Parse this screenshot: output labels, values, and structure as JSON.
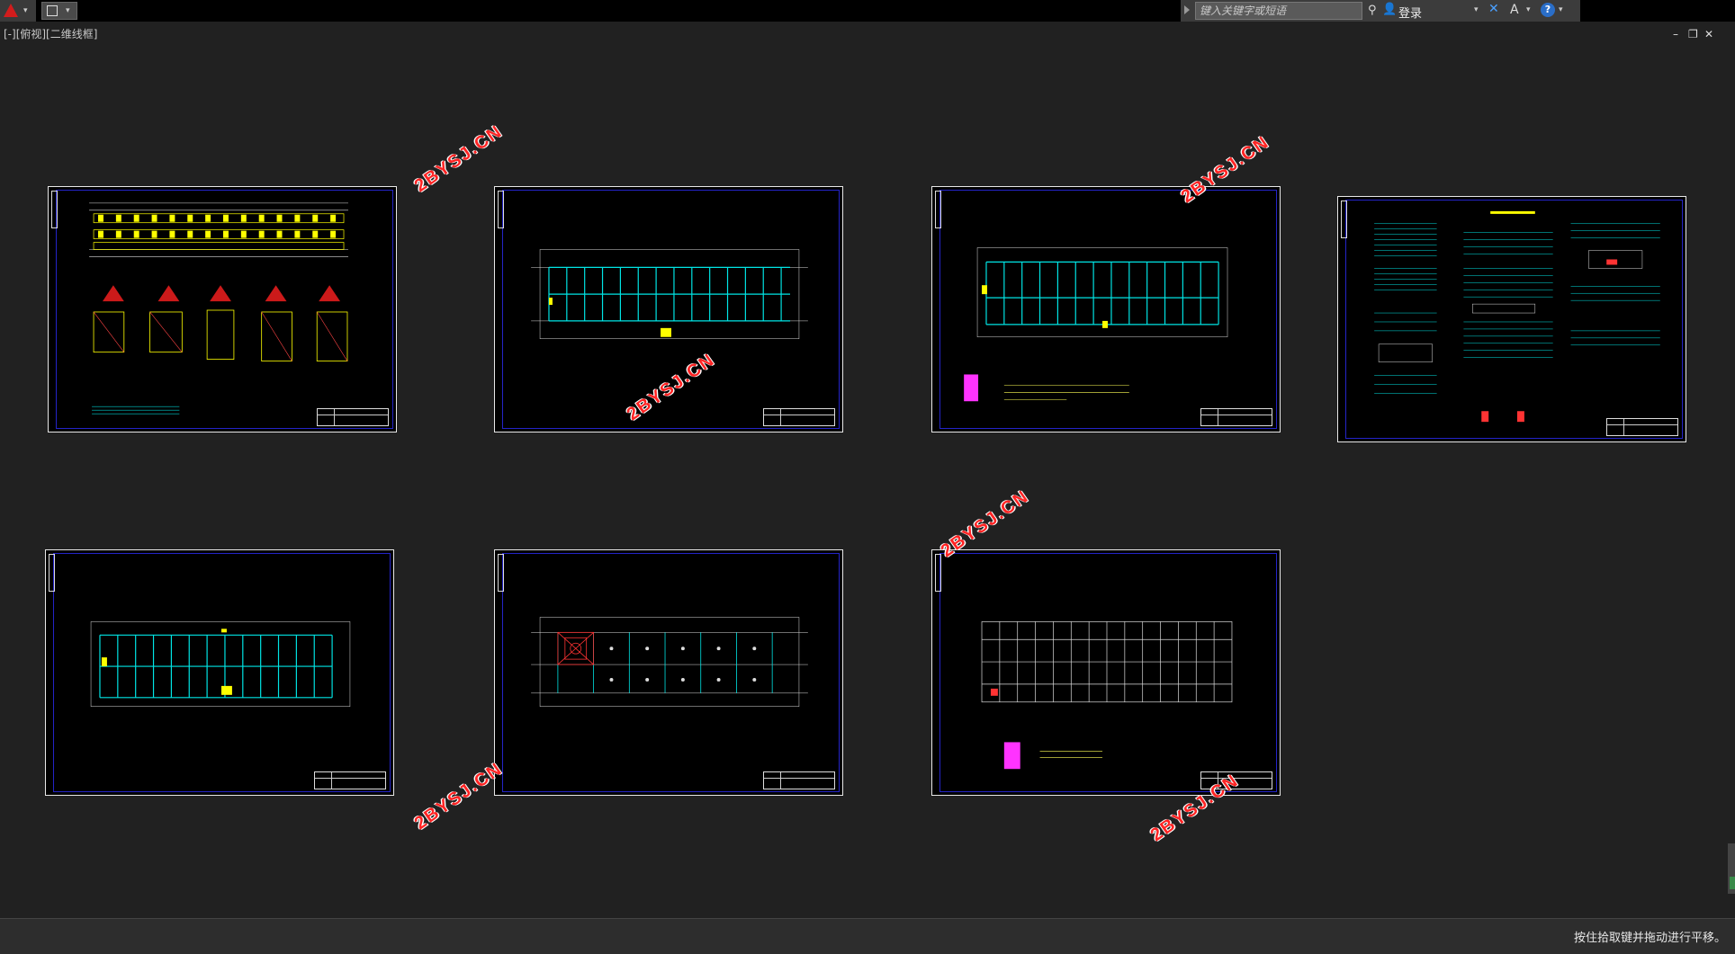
{
  "app": {
    "search_placeholder": "键入关键字或短语",
    "login_label": "登录",
    "viewport_label": "[-][俯视][二维线框]",
    "status_message": "按住拾取键并拖动进行平移。"
  },
  "window_controls": [
    "–",
    "❐",
    "✕"
  ],
  "watermark_text": "2BYSJ.CN",
  "sheets": [
    {
      "id": "foundation-plan",
      "color_accent": "#ffff00"
    },
    {
      "id": "floor-plan-1",
      "color_accent": "#00ffff"
    },
    {
      "id": "floor-plan-2",
      "color_accent": "#00ffff"
    },
    {
      "id": "design-notes",
      "color_accent": "#00ffff"
    },
    {
      "id": "floor-plan-3",
      "color_accent": "#00ffff"
    },
    {
      "id": "slab-plan",
      "color_accent": "#ff3333"
    },
    {
      "id": "roof-plan",
      "color_accent": "#ffffff"
    }
  ],
  "icons": [
    "autocad-logo-icon",
    "quick-access-icon",
    "binoculars-icon",
    "user-icon",
    "exchange-icon",
    "autodesk-icon",
    "help-icon"
  ]
}
